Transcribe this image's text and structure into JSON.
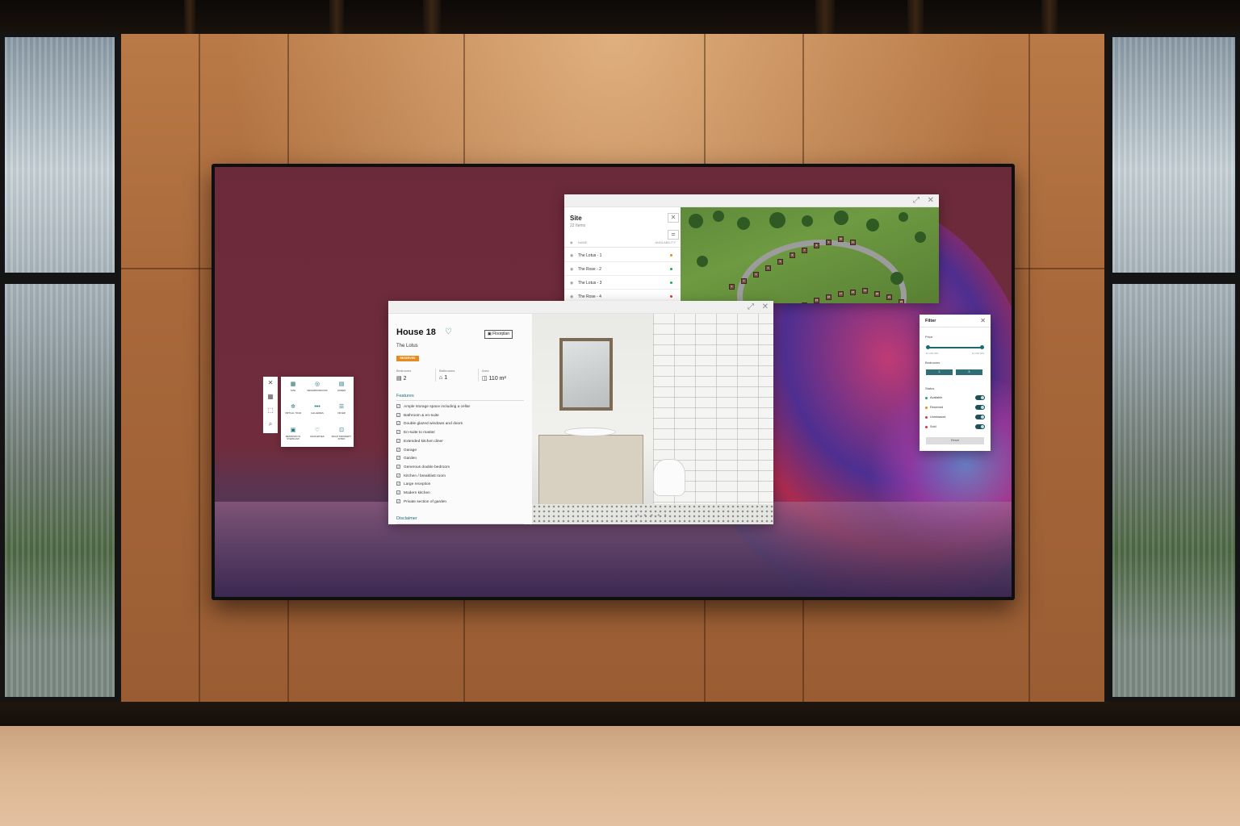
{
  "site": {
    "title": "Site",
    "count": "22 Items",
    "close_icon": "close-icon",
    "filter_icon": "filter-icon",
    "col_name": "NAME",
    "col_availability": "AVAILABILITY",
    "rows": [
      {
        "label": "The Lotus - 1",
        "status_color": "#e88a1c"
      },
      {
        "label": "The Rose - 2",
        "status_color": "#2aa65a"
      },
      {
        "label": "The Lotus - 3",
        "status_color": "#2aa65a"
      },
      {
        "label": "The Rose - 4",
        "status_color": "#d33b3b"
      }
    ],
    "map_plots": [
      "1",
      "2",
      "3",
      "4",
      "5",
      "6",
      "7",
      "8",
      "9",
      "10",
      "11",
      "12",
      "13",
      "14",
      "15",
      "16",
      "17",
      "18",
      "19",
      "20",
      "21",
      "22"
    ]
  },
  "house": {
    "title": "House 18",
    "subtitle": "The Lotus",
    "badge": "RESERVED",
    "floorplan_label": "Floorplan",
    "specs": [
      {
        "label": "Bedrooms",
        "value": "2"
      },
      {
        "label": "Bathrooms",
        "value": "1"
      },
      {
        "label": "Area",
        "value": "110 m²"
      }
    ],
    "features_heading": "Features",
    "features": [
      "Ample storage space including a cellar",
      "Bathroom & en-suite",
      "Double glazed windows and doors",
      "En-suite to master",
      "Extended kitchen diner",
      "Garage",
      "Garden",
      "Generous double bedroom",
      "Kitchen / breakfast room",
      "Large reception",
      "Modern kitchen",
      "Private section of garden"
    ],
    "disclaimer": "Disclaimer"
  },
  "filter": {
    "title": "Filter",
    "price_label": "Price",
    "price_min": "£1,000,000",
    "price_max": "£1,000,000",
    "bedrooms_label": "Bedrooms",
    "bedroom_options": [
      "2",
      "5"
    ],
    "status_label": "Status",
    "statuses": [
      {
        "label": "Available",
        "color": "#2aa65a"
      },
      {
        "label": "Reserved",
        "color": "#e88a1c"
      },
      {
        "label": "Unreleased",
        "color": "#d33b3b"
      },
      {
        "label": "Sold",
        "color": "#d33b3b"
      }
    ],
    "reset_label": "Reset"
  },
  "menu": {
    "items": [
      {
        "icon": "▦",
        "label": "SITE"
      },
      {
        "icon": "◎",
        "label": "NEIGHBOURHOOD"
      },
      {
        "icon": "▤",
        "label": "HOMES"
      },
      {
        "icon": "✲",
        "label": "VIRTUAL TOUR"
      },
      {
        "icon": "•••",
        "label": "GALLERIES"
      },
      {
        "icon": "☰",
        "label": "OFFER"
      },
      {
        "icon": "▣",
        "label": "BEDROOM IN STEPFLOW"
      },
      {
        "icon": "♡",
        "label": "FAVOURITES"
      },
      {
        "icon": "⊡",
        "label": "RIGHT PROPERTY INTRO"
      }
    ]
  },
  "tools": [
    "✕",
    "▦",
    "⬚",
    "⌕"
  ]
}
